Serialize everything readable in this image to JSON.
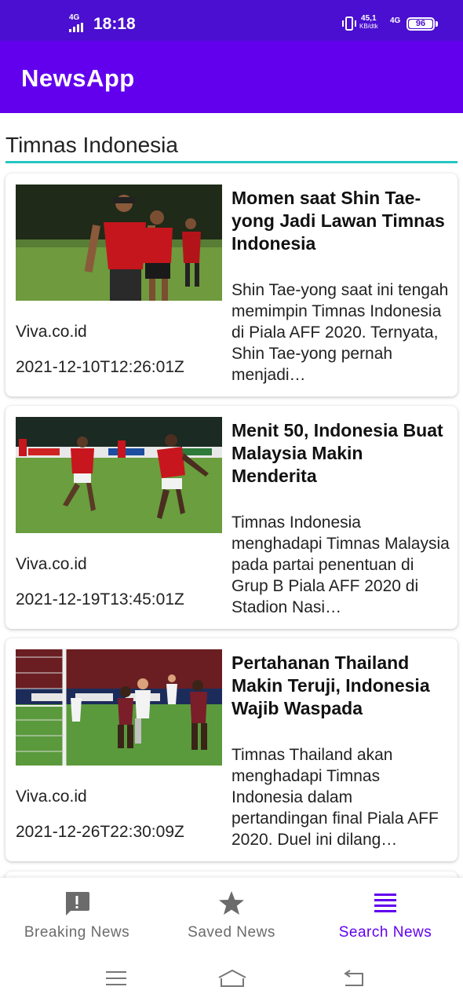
{
  "status_bar": {
    "network": "4G",
    "time": "18:18",
    "speed_value": "45,1",
    "speed_unit": "KB/dtk",
    "network2": "4G",
    "battery": "96"
  },
  "app_bar": {
    "title": "NewsApp"
  },
  "search": {
    "value": "Timnas Indonesia"
  },
  "articles": [
    {
      "title": "Momen saat Shin Tae-yong Jadi Lawan Timnas Indonesia",
      "description": "Shin Tae-yong saat ini tengah memimpin Timnas Indonesia di Piala AFF 2020. Ternyata, Shin Tae-yong pernah menjadi…",
      "source": "Viva.co.id",
      "date": "2021-12-10T12:26:01Z"
    },
    {
      "title": "Menit 50, Indonesia Buat Malaysia Makin Menderita",
      "description": "Timnas Indonesia menghadapi Timnas Malaysia pada partai penentuan di Grup B Piala AFF 2020 di Stadion Nasi…",
      "source": "Viva.co.id",
      "date": "2021-12-19T13:45:01Z"
    },
    {
      "title": "Pertahanan Thailand Makin Teruji, Indonesia Wajib Waspada",
      "description": "Timnas Thailand akan menghadapi Timnas Indonesia dalam pertandingan final Piala AFF 2020. Duel ini dilang…",
      "source": "Viva.co.id",
      "date": "2021-12-26T22:30:09Z"
    }
  ],
  "bottom_nav": {
    "items": [
      {
        "label": "Breaking News",
        "icon": "alert-icon"
      },
      {
        "label": "Saved News",
        "icon": "star-icon"
      },
      {
        "label": "Search News",
        "icon": "list-icon"
      }
    ],
    "active_index": 2
  },
  "colors": {
    "status_bar": "#4a0fd0",
    "app_bar": "#6200ee",
    "accent": "#26c6c0",
    "active_nav": "#6200ee"
  }
}
